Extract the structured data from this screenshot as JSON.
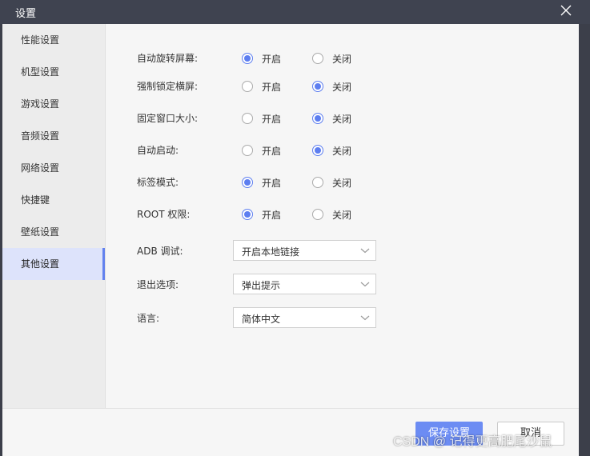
{
  "window": {
    "title": "设置"
  },
  "sidebar": {
    "items": [
      {
        "label": "性能设置",
        "active": false
      },
      {
        "label": "机型设置",
        "active": false
      },
      {
        "label": "游戏设置",
        "active": false
      },
      {
        "label": "音频设置",
        "active": false
      },
      {
        "label": "网络设置",
        "active": false
      },
      {
        "label": "快捷键",
        "active": false
      },
      {
        "label": "壁纸设置",
        "active": false
      },
      {
        "label": "其他设置",
        "active": true
      }
    ]
  },
  "options": {
    "on_label": "开启",
    "off_label": "关闭",
    "rows": [
      {
        "label": "自动旋转屏幕:",
        "selected": "on"
      },
      {
        "label": "强制锁定横屏:",
        "selected": "off"
      },
      {
        "label": "固定窗口大小:",
        "selected": "off"
      },
      {
        "label": "自动启动:",
        "selected": "off"
      },
      {
        "label": "标签模式:",
        "selected": "on"
      },
      {
        "label": "ROOT 权限:",
        "selected": "on"
      }
    ]
  },
  "selects": [
    {
      "label": "ADB 调试:",
      "value": "开启本地链接"
    },
    {
      "label": "退出选项:",
      "value": "弹出提示"
    },
    {
      "label": "语言:",
      "value": "简体中文"
    }
  ],
  "footer": {
    "save_label": "保存设置",
    "cancel_label": "取消"
  },
  "watermark": {
    "text": "CSDN @ 记得更高肥尾沙鼠"
  },
  "colors": {
    "accent": "#5d7ef0",
    "titlebar": "#3f4350",
    "sidebar_active": "#dde3fb"
  }
}
